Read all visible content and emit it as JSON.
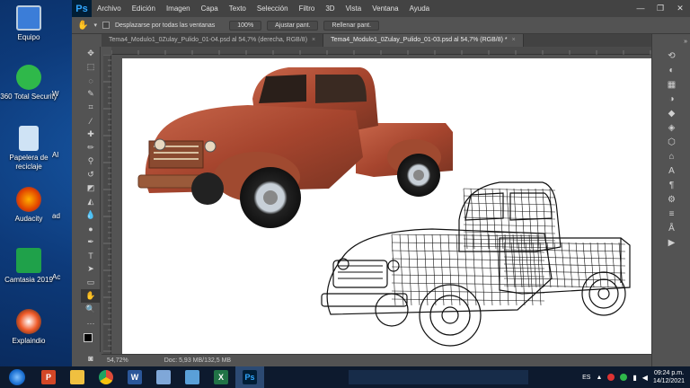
{
  "desktop": {
    "icons": [
      {
        "label": "Equipo",
        "cut": ""
      },
      {
        "label": "360 Total Security",
        "cut": "W"
      },
      {
        "label": "Papelera de reciclaje",
        "cut": "Al"
      },
      {
        "label": "Audacity",
        "cut": "ad"
      },
      {
        "label": "Camtasia 2019",
        "cut": "Ac"
      },
      {
        "label": "Explaindio",
        "cut": ""
      }
    ]
  },
  "photoshop": {
    "logo": "Ps",
    "menu": [
      "Archivo",
      "Edición",
      "Imagen",
      "Capa",
      "Texto",
      "Selección",
      "Filtro",
      "3D",
      "Vista",
      "Ventana",
      "Ayuda"
    ],
    "window_controls": [
      "—",
      "❐",
      "✕"
    ],
    "options": {
      "scroll_all_label": "Desplazarse por todas las ventanas",
      "zoom_value": "100%",
      "fit_screen": "Ajustar pant.",
      "fill_screen": "Rellenar pant."
    },
    "tabs": [
      {
        "label": "Tema4_Modulo1_0Zulay_Pulido_01-04.psd al 54,7% (derecha, RGB/8)",
        "close": "×"
      },
      {
        "label": "Tema4_Modulo1_0Zulay_Pulido_01-03.psd al 54,7% (RGB/8) *",
        "close": "×"
      }
    ],
    "status": {
      "zoom": "54,72%",
      "doc": "Doc: 5,93 MB/132,5 MB"
    },
    "colors": {
      "accent": "#31a8ff",
      "chrome": "#535353",
      "dark": "#434343"
    }
  },
  "taskbar": {
    "apps": [
      {
        "name": "powerpoint",
        "glyph": "P",
        "color": "#d24726"
      },
      {
        "name": "explorer",
        "glyph": "",
        "color": "#f0c040"
      },
      {
        "name": "chrome",
        "glyph": "",
        "color": "#dd4b39"
      },
      {
        "name": "word",
        "glyph": "W",
        "color": "#2b579a"
      },
      {
        "name": "notepad",
        "glyph": "",
        "color": "#7fa7d8"
      },
      {
        "name": "app",
        "glyph": "",
        "color": "#5aa0d8"
      },
      {
        "name": "excel",
        "glyph": "X",
        "color": "#217346"
      },
      {
        "name": "photoshop",
        "glyph": "Ps",
        "color": "#001e36"
      }
    ],
    "language": "ES",
    "time": "09:24 p.m.",
    "date": "14/12/2021"
  }
}
